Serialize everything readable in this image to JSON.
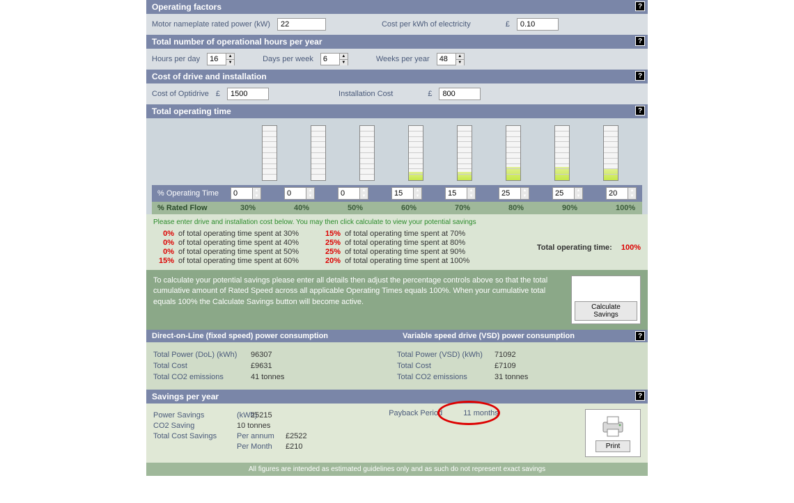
{
  "sections": {
    "operating_factors": {
      "title": "Operating factors",
      "motor_label": "Motor nameplate rated power (kW)",
      "motor_value": "22",
      "cost_kwh_label": "Cost per kWh of electricity",
      "currency": "£",
      "cost_kwh_value": "0.10"
    },
    "operational_hours": {
      "title": "Total number of operational hours per year",
      "hours_day_label": "Hours per day",
      "hours_day": "16",
      "days_week_label": "Days per week",
      "days_week": "6",
      "weeks_year_label": "Weeks per year",
      "weeks_year": "48"
    },
    "cost_drive": {
      "title": "Cost of drive and installation",
      "optidrive_label": "Cost of Optidrive",
      "currency": "£",
      "optidrive_value": "1500",
      "install_label": "Installation Cost",
      "install_value": "800"
    },
    "operating_time": {
      "title": "Total operating time",
      "row_label": "% Operating Time",
      "flow_label": "% Rated Flow",
      "values": [
        "0",
        "0",
        "0",
        "15",
        "15",
        "25",
        "25",
        "20"
      ],
      "fills": [
        0,
        0,
        0,
        15,
        15,
        25,
        25,
        20
      ],
      "flows": [
        "30%",
        "40%",
        "50%",
        "60%",
        "70%",
        "80%",
        "90%",
        "100%"
      ]
    },
    "summary": {
      "note": "Please enter drive and installation cost below. You may then click calculate to view your potential savings",
      "left": [
        {
          "pct": "0%",
          "txt": "of total operating time spent at 30%"
        },
        {
          "pct": "0%",
          "txt": "of total operating time spent at 40%"
        },
        {
          "pct": "0%",
          "txt": "of total operating time spent at 50%"
        },
        {
          "pct": "15%",
          "txt": "of total operating time spent at 60%"
        }
      ],
      "right": [
        {
          "pct": "15%",
          "txt": "of total operating time spent at 70%"
        },
        {
          "pct": "25%",
          "txt": "of total operating time spent at 80%"
        },
        {
          "pct": "25%",
          "txt": "of total operating time spent at 90%"
        },
        {
          "pct": "20%",
          "txt": "of total operating time spent at 100%"
        }
      ],
      "total_label": "Total operating time:",
      "total_value": "100%"
    },
    "calc": {
      "text": "To calculate your potential savings please enter all details then adjust the percentage controls above so that the total cumulative amount of Rated Speed across all applicable Operating Times equals 100%. When your cumulative total equals 100% the Calculate Savings button will become active.",
      "btn": "Calculate Savings"
    },
    "results": {
      "dol_title": "Direct-on-Line (fixed speed) power consumption",
      "vsd_title": "Variable speed drive (VSD) power consumption",
      "dol": {
        "power_label": "Total Power (DoL) (kWh)",
        "power": "96307",
        "cost_label": "Total Cost",
        "cost": "£9631",
        "co2_label": "Total CO2 emissions",
        "co2": "41 tonnes"
      },
      "vsd": {
        "power_label": "Total Power (VSD) (kWh)",
        "power": "71092",
        "cost_label": "Total Cost",
        "cost": "£7109",
        "co2_label": "Total CO2 emissions",
        "co2": "31 tonnes"
      }
    },
    "savings": {
      "title": "Savings per year",
      "power_label": "Power Savings",
      "power_unit": "(kWh)",
      "power_value": "25215",
      "co2_label": "CO2 Saving",
      "co2_value": "10 tonnes",
      "total_label": "Total Cost Savings",
      "annum_label": "Per annum",
      "annum_value": "£2522",
      "month_label": "Per Month",
      "month_value": "£210",
      "payback_label": "Payback Period",
      "payback_value": "11 months",
      "print": "Print"
    },
    "footer": "All figures are intended as estimated guidelines only and as such do not represent exact savings"
  }
}
